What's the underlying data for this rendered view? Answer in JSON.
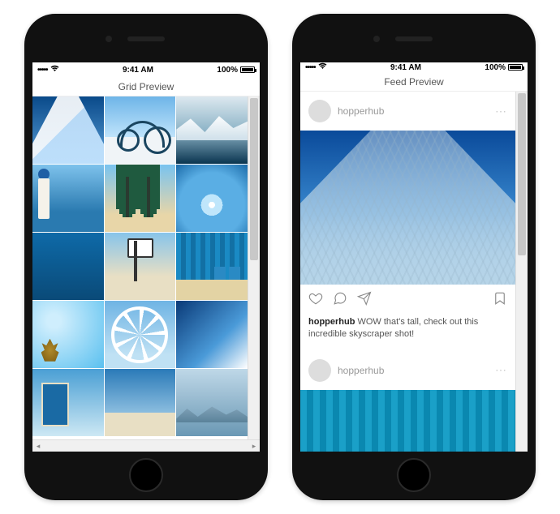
{
  "statusbar": {
    "signal": "•••••",
    "wifi": "􀙇",
    "time": "9:41 AM",
    "battery_pct": "100%"
  },
  "left_phone": {
    "title": "Grid Preview"
  },
  "right_phone": {
    "title": "Feed Preview",
    "post1": {
      "username": "hopperhub",
      "caption_user": "hopperhub",
      "caption_text": " WOW that's tall, check out this incredible skyscraper shot!"
    },
    "post2": {
      "username": "hopperhub"
    }
  }
}
